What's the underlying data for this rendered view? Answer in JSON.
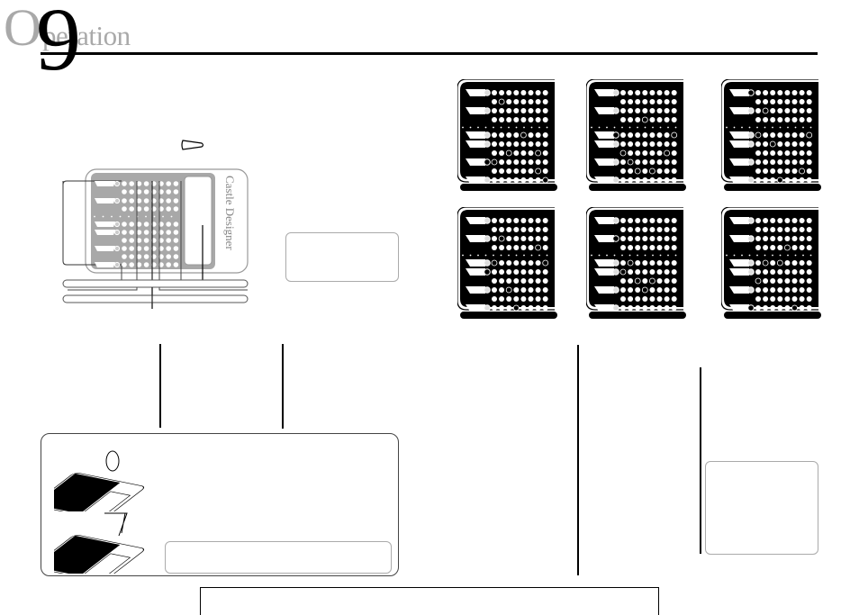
{
  "header": {
    "title_initial": "O",
    "title_rest": "peration",
    "page_number": "9"
  },
  "illustration": {
    "brand_text": "Castle Designer",
    "icon": "ear-plug-icon"
  },
  "boards": [
    {
      "rows": [
        "LFFFFFFFF",
        "-FOFFFFFF",
        "LFFFFFFFF",
        "-FFFFFFFF",
        "LFFFFOFFF",
        "LFFFFFFFF",
        "-FFOFFFOF",
        "BOFFFFFFF",
        "-FFFFFFOF",
        "LFFFFFFFO"
      ]
    },
    {
      "rows": [
        "LFFFFFFFF",
        "-FFFFFFFF",
        "LFFFFFFFF",
        "-FFFOFFFF",
        "BFFFFFFFO",
        "LFFFFFFFF",
        "-OFFFFFOF",
        "LFOFFFFFF",
        "-FFOFOFFF",
        "LFFFFFFFF"
      ]
    },
    {
      "rows": [
        "BFFFFFFFF",
        "-FFFFFFFF",
        "LFOFFFFFF",
        "-FFFFFFFF",
        "LOFFFFFFO",
        "LFFOFFFFF",
        "-FFFFFFFF",
        "LFFFFFFFF",
        "-FFFFFFOF",
        "LFFFOFFFF"
      ]
    },
    {
      "rows": [
        "LFFFFFFFF",
        "-FFFFFFFF",
        "LFOFFFFFF",
        "-FFFFFFOF",
        "LOFFFFFFO",
        "BFFFFFFFF",
        "-FFFFFFFF",
        "LFFOFFFFF",
        "-FFFFFFFF",
        "LFFFOFFFF"
      ]
    },
    {
      "rows": [
        "LFFFFFFFF",
        "-FFFFFFFF",
        "BFFFFFFFF",
        "-FFFFFFFF",
        "LFOFFFFFF",
        "LOFFFFFFF",
        "-FFOFOFFF",
        "LFFFOFFFF",
        "-FFFFFFFF",
        "LFFFFFFFF"
      ]
    },
    {
      "rows": [
        "LFFFFFFFF",
        "-FFFFFFFF",
        "LFFFFFFFF",
        "-FFFFOFFF",
        "LFOFOFFFF",
        "LFFFFFFFF",
        "-OFFFFFFF",
        "LFFFFFFFF",
        "-FFFFFFFF",
        "BFFFFFOFF"
      ]
    }
  ]
}
